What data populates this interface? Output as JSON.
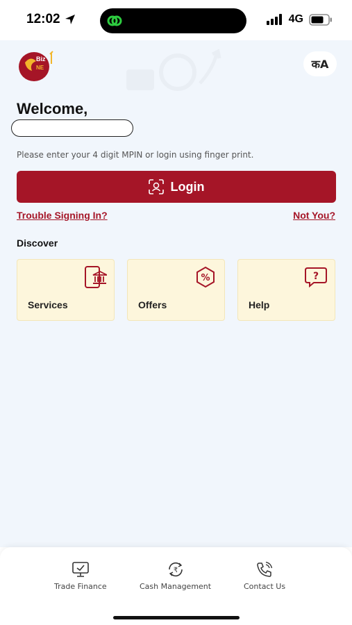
{
  "status_bar": {
    "time": "12:02",
    "network": "4G"
  },
  "header": {
    "language_toggle_label": "कA"
  },
  "welcome": {
    "title": "Welcome,",
    "name": ""
  },
  "login": {
    "hint": "Please enter your 4 digit MPIN or login using finger print.",
    "button_label": "Login",
    "trouble_link": "Trouble Signing In?",
    "not_you_link": "Not You?"
  },
  "discover": {
    "title": "Discover",
    "cards": [
      {
        "label": "Services",
        "icon": "bank-phone-icon"
      },
      {
        "label": "Offers",
        "icon": "percent-badge-icon"
      },
      {
        "label": "Help",
        "icon": "question-bubble-icon"
      }
    ]
  },
  "bottom_nav": {
    "items": [
      {
        "label": "Trade Finance",
        "icon": "monitor-check-icon"
      },
      {
        "label": "Cash Management",
        "icon": "rupee-cycle-icon"
      },
      {
        "label": "Contact Us",
        "icon": "phone-icon"
      }
    ]
  },
  "colors": {
    "brand": "#a51527",
    "background": "#f1f6fc",
    "card": "#fdf6dc"
  }
}
